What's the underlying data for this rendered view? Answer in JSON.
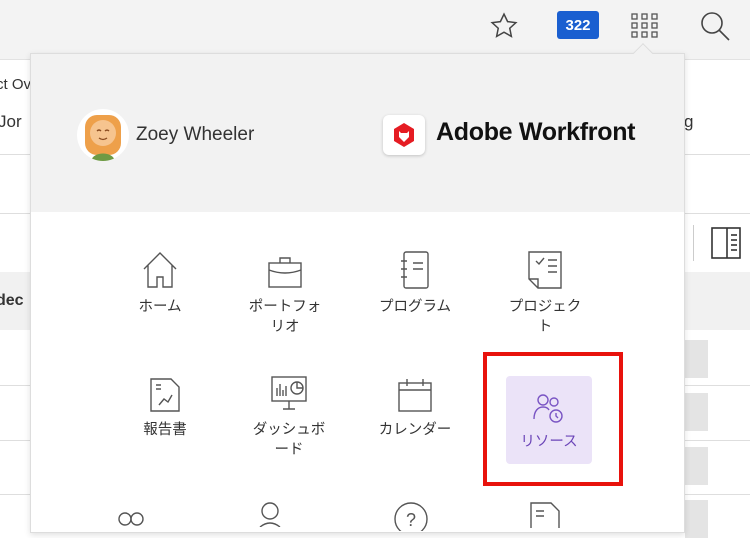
{
  "topbar": {
    "notification_count": "322",
    "icons": [
      "star-icon",
      "grid-icon",
      "search-icon"
    ]
  },
  "background": {
    "text_a": "ct Ov",
    "text_b": "Jor",
    "text_c": "g",
    "column_header": "dec"
  },
  "menu": {
    "user_name": "Zoey Wheeler",
    "brand": "Adobe Workfront",
    "items": [
      {
        "label": "ホーム",
        "icon": "home-icon"
      },
      {
        "label": "ポートフォリオ",
        "icon": "briefcase-icon"
      },
      {
        "label": "プログラム",
        "icon": "notebook-icon"
      },
      {
        "label": "プロジェクト",
        "icon": "checklist-icon"
      },
      {
        "label": "報告書",
        "icon": "report-icon"
      },
      {
        "label": "ダッシュボード",
        "icon": "dashboard-icon"
      },
      {
        "label": "カレンダー",
        "icon": "calendar-icon"
      },
      {
        "label": "リソース",
        "icon": "resources-icon",
        "selected": true
      }
    ],
    "accent": "#6b45b8",
    "highlight": "#e8120c"
  }
}
